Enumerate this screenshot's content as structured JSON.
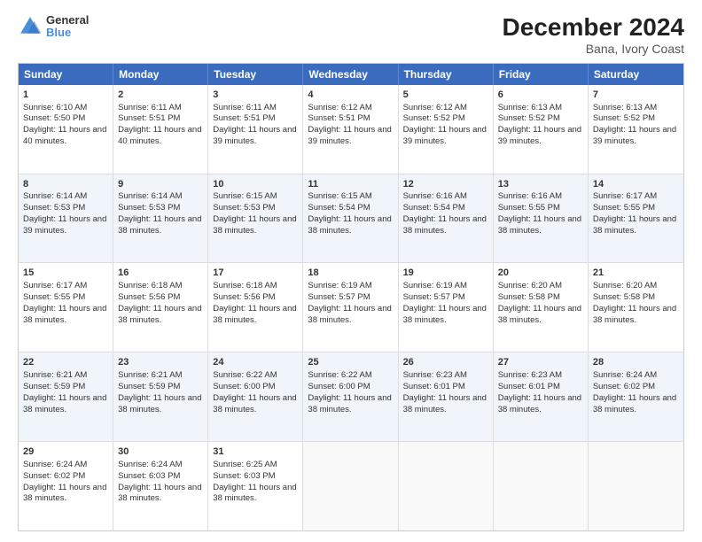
{
  "header": {
    "logo_line1": "General",
    "logo_line2": "Blue",
    "title": "December 2024",
    "subtitle": "Bana, Ivory Coast"
  },
  "days": [
    "Sunday",
    "Monday",
    "Tuesday",
    "Wednesday",
    "Thursday",
    "Friday",
    "Saturday"
  ],
  "rows": [
    [
      {
        "num": "1",
        "rise": "6:10 AM",
        "set": "5:50 PM",
        "daylight": "11 hours and 40 minutes."
      },
      {
        "num": "2",
        "rise": "6:11 AM",
        "set": "5:51 PM",
        "daylight": "11 hours and 40 minutes."
      },
      {
        "num": "3",
        "rise": "6:11 AM",
        "set": "5:51 PM",
        "daylight": "11 hours and 39 minutes."
      },
      {
        "num": "4",
        "rise": "6:12 AM",
        "set": "5:51 PM",
        "daylight": "11 hours and 39 minutes."
      },
      {
        "num": "5",
        "rise": "6:12 AM",
        "set": "5:52 PM",
        "daylight": "11 hours and 39 minutes."
      },
      {
        "num": "6",
        "rise": "6:13 AM",
        "set": "5:52 PM",
        "daylight": "11 hours and 39 minutes."
      },
      {
        "num": "7",
        "rise": "6:13 AM",
        "set": "5:52 PM",
        "daylight": "11 hours and 39 minutes."
      }
    ],
    [
      {
        "num": "8",
        "rise": "6:14 AM",
        "set": "5:53 PM",
        "daylight": "11 hours and 39 minutes."
      },
      {
        "num": "9",
        "rise": "6:14 AM",
        "set": "5:53 PM",
        "daylight": "11 hours and 38 minutes."
      },
      {
        "num": "10",
        "rise": "6:15 AM",
        "set": "5:53 PM",
        "daylight": "11 hours and 38 minutes."
      },
      {
        "num": "11",
        "rise": "6:15 AM",
        "set": "5:54 PM",
        "daylight": "11 hours and 38 minutes."
      },
      {
        "num": "12",
        "rise": "6:16 AM",
        "set": "5:54 PM",
        "daylight": "11 hours and 38 minutes."
      },
      {
        "num": "13",
        "rise": "6:16 AM",
        "set": "5:55 PM",
        "daylight": "11 hours and 38 minutes."
      },
      {
        "num": "14",
        "rise": "6:17 AM",
        "set": "5:55 PM",
        "daylight": "11 hours and 38 minutes."
      }
    ],
    [
      {
        "num": "15",
        "rise": "6:17 AM",
        "set": "5:55 PM",
        "daylight": "11 hours and 38 minutes."
      },
      {
        "num": "16",
        "rise": "6:18 AM",
        "set": "5:56 PM",
        "daylight": "11 hours and 38 minutes."
      },
      {
        "num": "17",
        "rise": "6:18 AM",
        "set": "5:56 PM",
        "daylight": "11 hours and 38 minutes."
      },
      {
        "num": "18",
        "rise": "6:19 AM",
        "set": "5:57 PM",
        "daylight": "11 hours and 38 minutes."
      },
      {
        "num": "19",
        "rise": "6:19 AM",
        "set": "5:57 PM",
        "daylight": "11 hours and 38 minutes."
      },
      {
        "num": "20",
        "rise": "6:20 AM",
        "set": "5:58 PM",
        "daylight": "11 hours and 38 minutes."
      },
      {
        "num": "21",
        "rise": "6:20 AM",
        "set": "5:58 PM",
        "daylight": "11 hours and 38 minutes."
      }
    ],
    [
      {
        "num": "22",
        "rise": "6:21 AM",
        "set": "5:59 PM",
        "daylight": "11 hours and 38 minutes."
      },
      {
        "num": "23",
        "rise": "6:21 AM",
        "set": "5:59 PM",
        "daylight": "11 hours and 38 minutes."
      },
      {
        "num": "24",
        "rise": "6:22 AM",
        "set": "6:00 PM",
        "daylight": "11 hours and 38 minutes."
      },
      {
        "num": "25",
        "rise": "6:22 AM",
        "set": "6:00 PM",
        "daylight": "11 hours and 38 minutes."
      },
      {
        "num": "26",
        "rise": "6:23 AM",
        "set": "6:01 PM",
        "daylight": "11 hours and 38 minutes."
      },
      {
        "num": "27",
        "rise": "6:23 AM",
        "set": "6:01 PM",
        "daylight": "11 hours and 38 minutes."
      },
      {
        "num": "28",
        "rise": "6:24 AM",
        "set": "6:02 PM",
        "daylight": "11 hours and 38 minutes."
      }
    ],
    [
      {
        "num": "29",
        "rise": "6:24 AM",
        "set": "6:02 PM",
        "daylight": "11 hours and 38 minutes."
      },
      {
        "num": "30",
        "rise": "6:24 AM",
        "set": "6:03 PM",
        "daylight": "11 hours and 38 minutes."
      },
      {
        "num": "31",
        "rise": "6:25 AM",
        "set": "6:03 PM",
        "daylight": "11 hours and 38 minutes."
      },
      null,
      null,
      null,
      null
    ]
  ]
}
